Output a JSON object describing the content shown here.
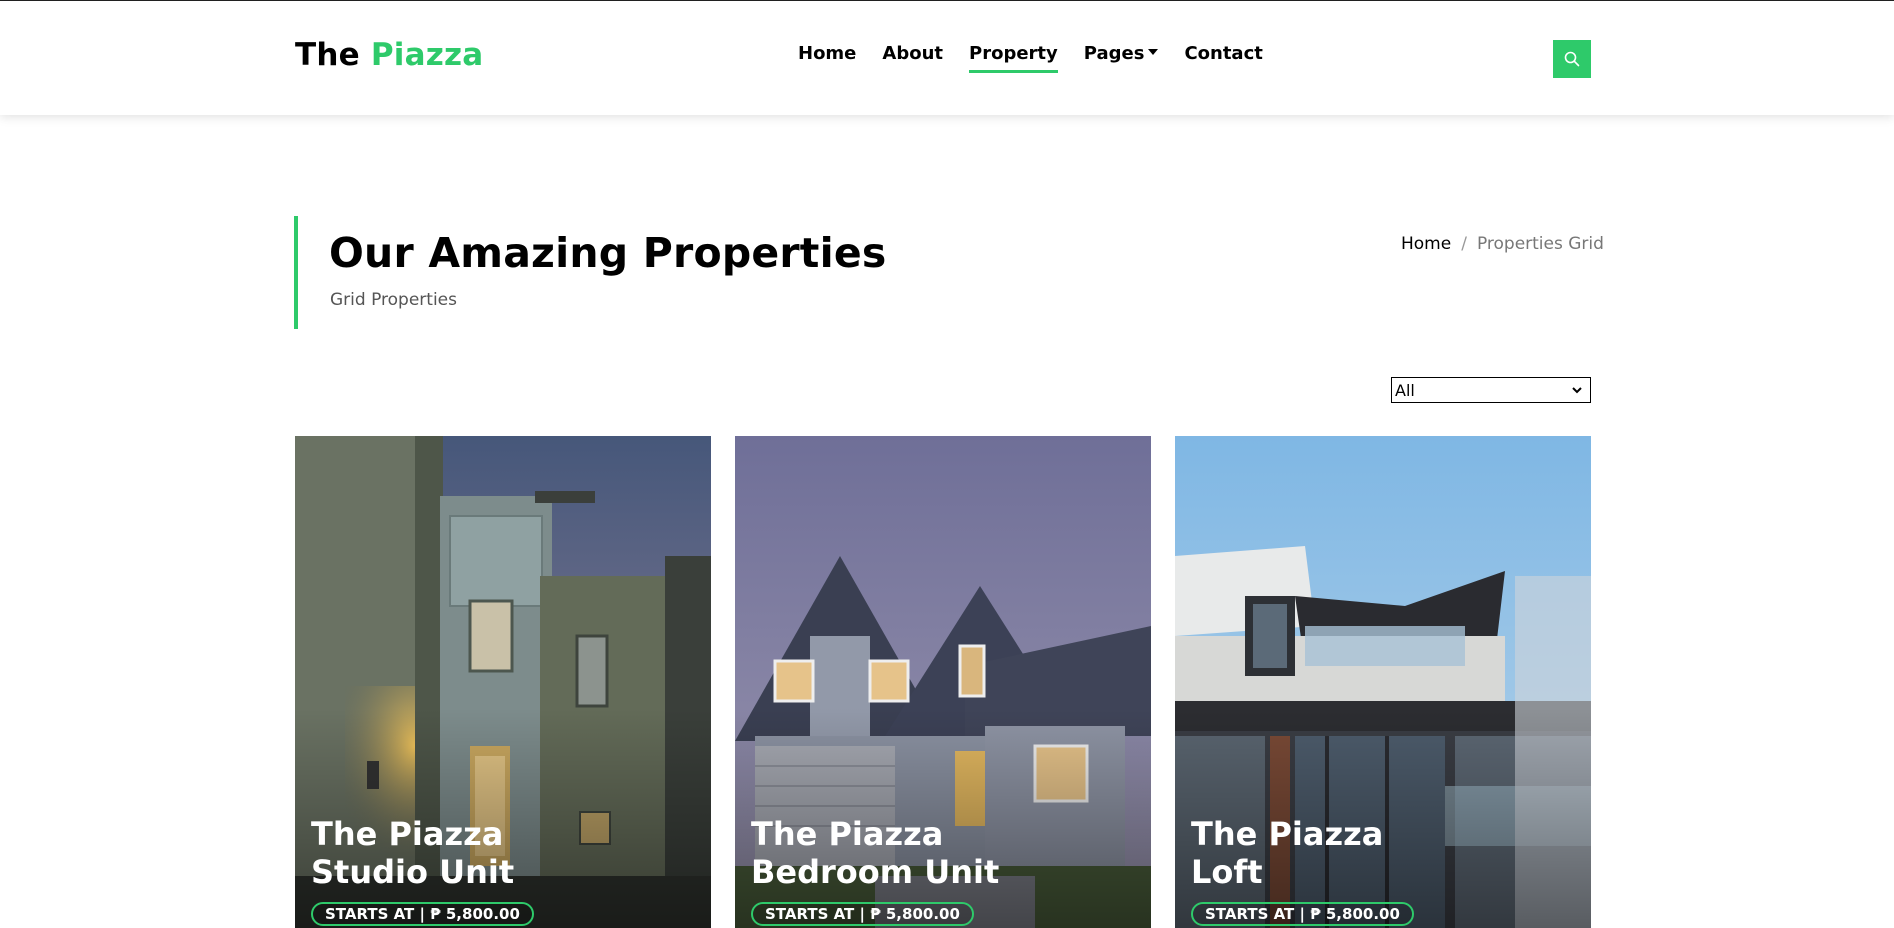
{
  "brand": {
    "prefix": "The",
    "accent": "Piazza"
  },
  "nav": {
    "items": [
      {
        "label": "Home"
      },
      {
        "label": "About"
      },
      {
        "label": "Property",
        "active": true
      },
      {
        "label": "Pages",
        "dropdown": true
      },
      {
        "label": "Contact"
      }
    ],
    "search_icon": "search-icon"
  },
  "intro": {
    "title": "Our Amazing Properties",
    "subtitle": "Grid Properties"
  },
  "breadcrumb": {
    "home": "Home",
    "separator": "/",
    "current": "Properties Grid"
  },
  "filter": {
    "selected": "All"
  },
  "properties": [
    {
      "title_line1": "The Piazza",
      "title_line2": "Studio Unit",
      "price": "STARTS AT | ₱ 5,800.00"
    },
    {
      "title_line1": "The Piazza",
      "title_line2": "Bedroom Unit",
      "price": "STARTS AT | ₱ 5,800.00"
    },
    {
      "title_line1": "The Piazza",
      "title_line2": "Loft",
      "price": "STARTS AT | ₱ 5,800.00"
    }
  ],
  "colors": {
    "accent": "#2eca6a",
    "text": "#000000",
    "muted": "#555555"
  }
}
